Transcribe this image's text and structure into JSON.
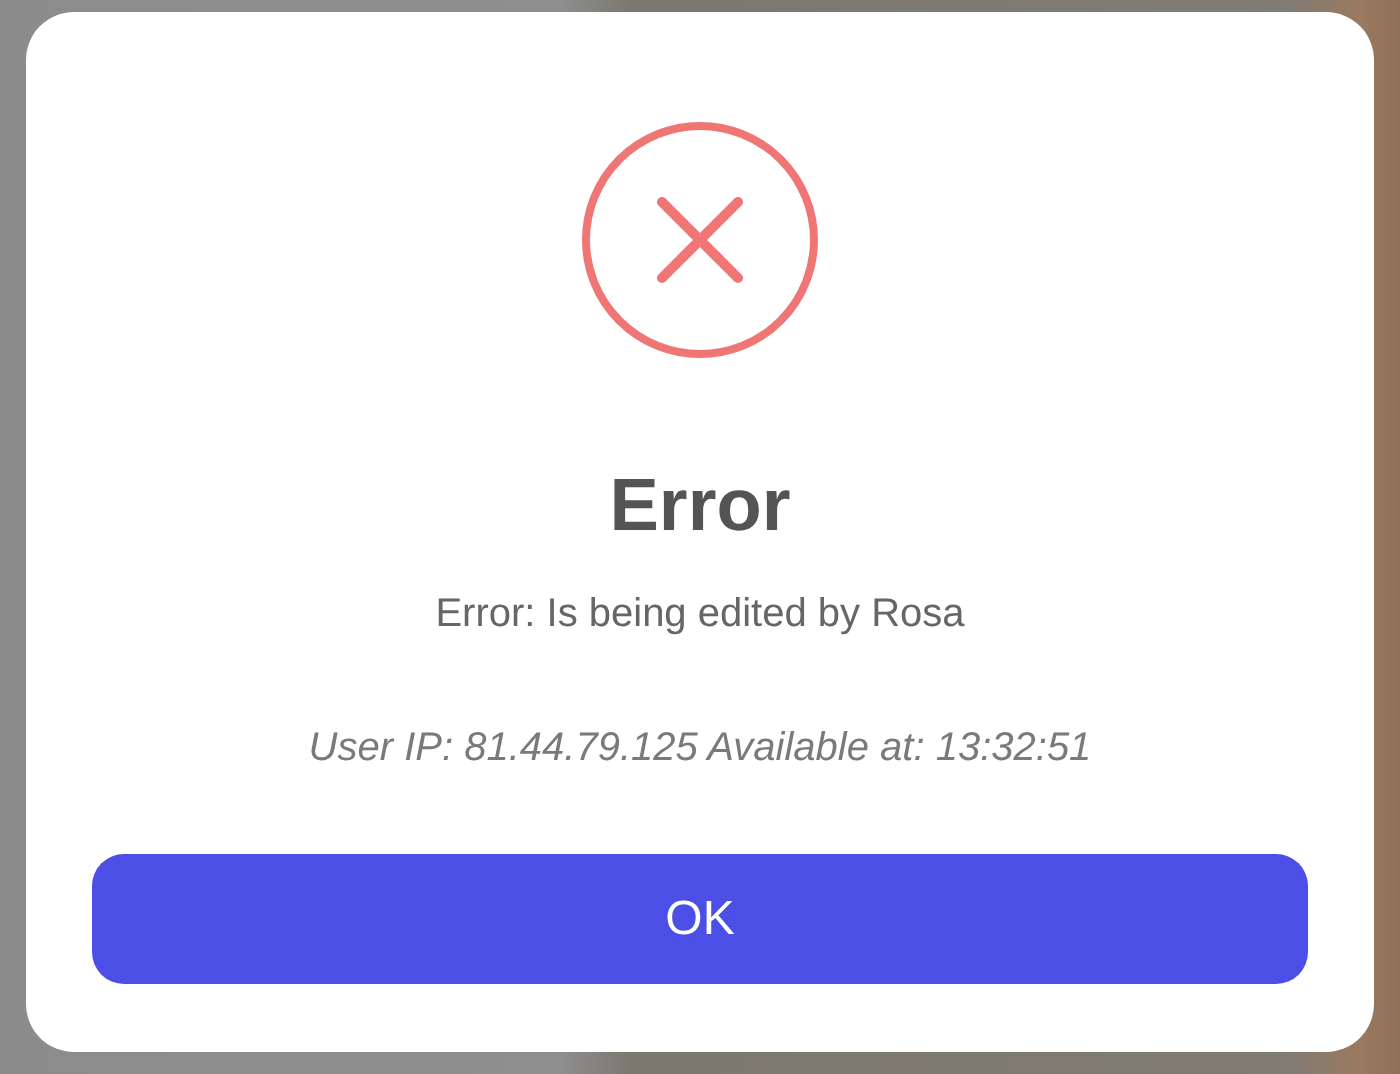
{
  "dialog": {
    "kind": "error",
    "title": "Error",
    "message": "Error: Is being edited by Rosa",
    "detail": "User IP: 81.44.79.125 Available at: 13:32:51",
    "buttons": [
      "OK"
    ]
  }
}
